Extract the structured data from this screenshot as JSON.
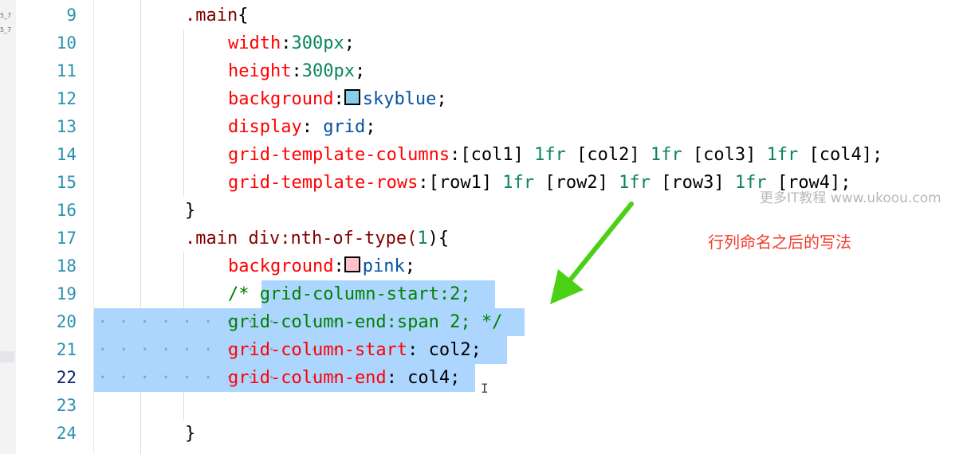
{
  "left_strip": {
    "marks": [
      "5_7",
      "5_7"
    ]
  },
  "gutter": {
    "active_line": "22",
    "lines": [
      "9",
      "10",
      "11",
      "12",
      "13",
      "14",
      "15",
      "16",
      "17",
      "18",
      "19",
      "20",
      "21",
      "22",
      "23",
      "24"
    ]
  },
  "code": {
    "l9": {
      "selector": ".main",
      "brace": "{"
    },
    "l10": {
      "prop": "width",
      "colon": ":",
      "num": "300px",
      "semi": ";"
    },
    "l11": {
      "prop": "height",
      "colon": ":",
      "num": "300px",
      "semi": ";"
    },
    "l12": {
      "prop": "background",
      "colon": ":",
      "swatch_color": "#87ceeb",
      "value": "skyblue",
      "semi": ";"
    },
    "l13": {
      "prop": "display",
      "colon": ": ",
      "value": "grid",
      "semi": ";"
    },
    "l14": {
      "prop": "grid-template-columns",
      "colon": ":",
      "value_parts": [
        "[col1] ",
        "1fr",
        " [col2] ",
        "1fr",
        " [col3] ",
        "1fr",
        " [col4];"
      ]
    },
    "l15": {
      "prop": "grid-template-rows",
      "colon": ":",
      "value_parts": [
        "[row1] ",
        "1fr",
        " [row2] ",
        "1fr",
        " [row3] ",
        "1fr",
        " [row4];"
      ]
    },
    "l16": {
      "brace": "}"
    },
    "l17": {
      "selector": ".main div:nth-of-type(",
      "num": "1",
      "rest": "){"
    },
    "l18": {
      "prop": "background",
      "colon": ":",
      "swatch_color": "#ffc0cb",
      "value": "pink",
      "semi": ";"
    },
    "l19": {
      "comment_open": "/* ",
      "text": "grid-column-start:2;"
    },
    "l20": {
      "text": "grid-column-end:span 2;",
      "comment_close": " */"
    },
    "l21": {
      "prop": "grid-column-start",
      "colon": ":",
      "value": " col2",
      "semi": ";"
    },
    "l22": {
      "prop": "grid-column-end",
      "colon": ":",
      "value": " col4",
      "semi": ";"
    },
    "l24": {
      "brace": "}"
    }
  },
  "watermark": "更多IT教程 www.ukoou.com",
  "annotation": "行列命名之后的写法",
  "colors": {
    "annotation": "#f23b2b",
    "arrow": "#4cd016",
    "selection": "#add6ff",
    "line_number": "#2b91af"
  },
  "icons": {
    "arrow": "green-diagonal-arrow-icon",
    "cursor": "text-cursor-icon"
  }
}
